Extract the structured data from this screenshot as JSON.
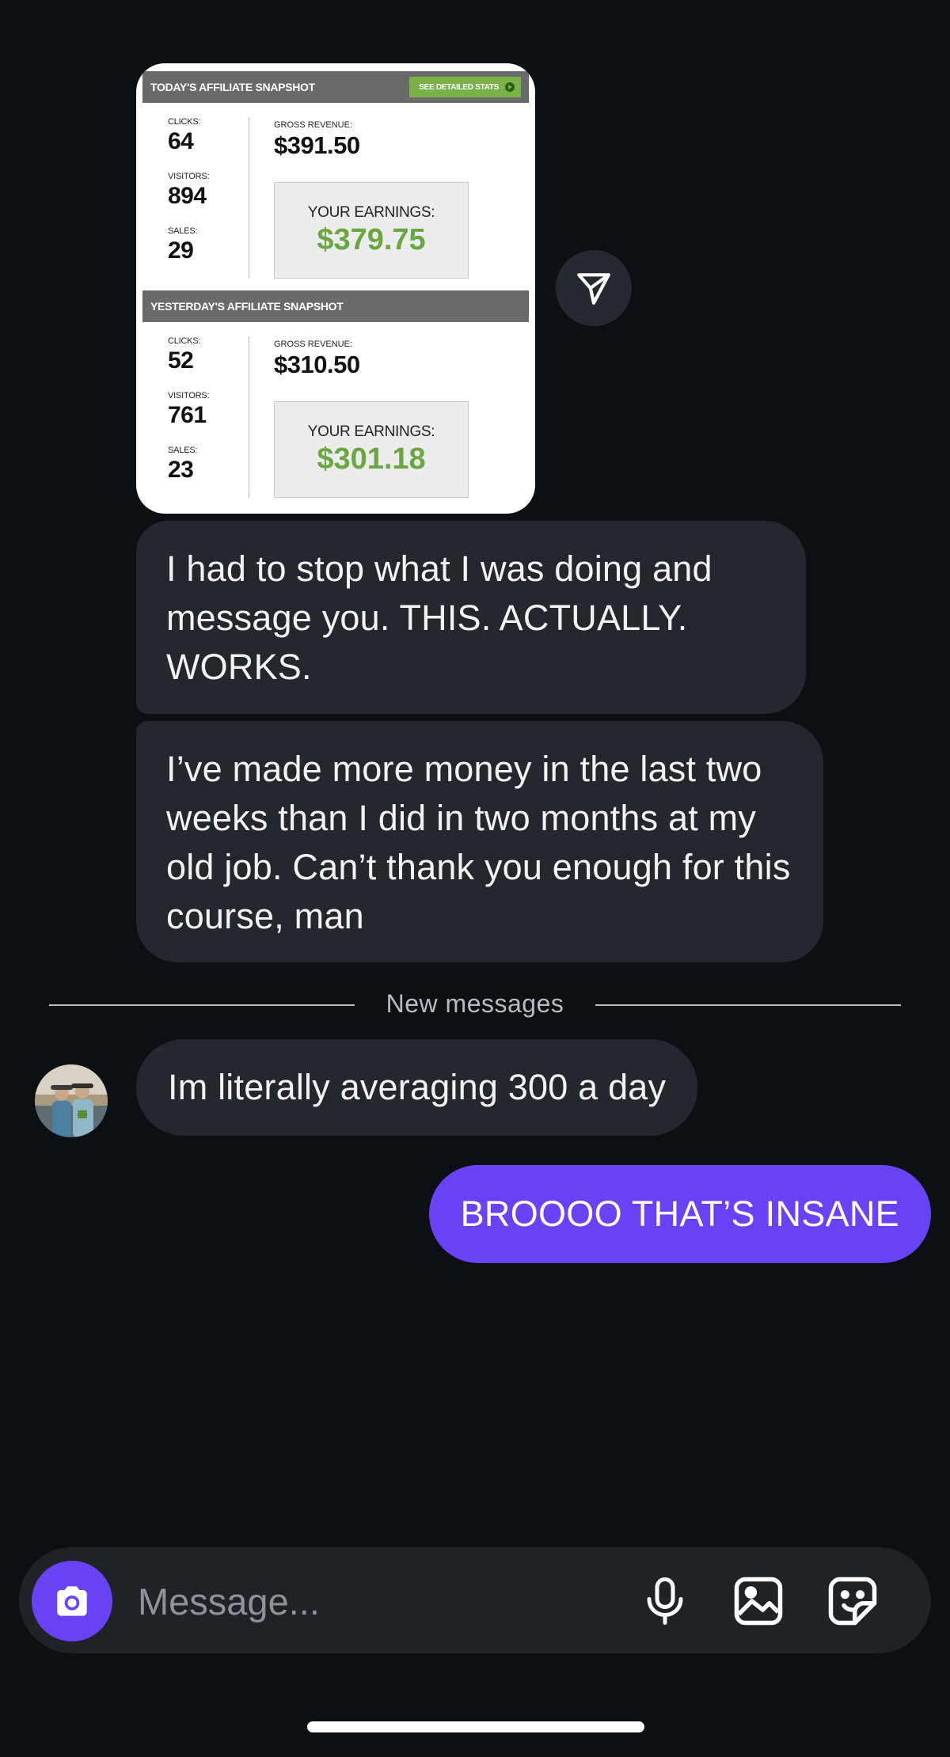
{
  "snapshot": {
    "today": {
      "title": "TODAY'S AFFILIATE SNAPSHOT",
      "stats_button": "SEE DETAILED STATS",
      "clicks_label": "CLICKS:",
      "clicks": "64",
      "visitors_label": "VISITORS:",
      "visitors": "894",
      "sales_label": "SALES:",
      "sales": "29",
      "gross_label": "GROSS REVENUE:",
      "gross": "$391.50",
      "earnings_label": "YOUR EARNINGS:",
      "earnings": "$379.75"
    },
    "yesterday": {
      "title": "YESTERDAY'S AFFILIATE SNAPSHOT",
      "clicks_label": "CLICKS:",
      "clicks": "52",
      "visitors_label": "VISITORS:",
      "visitors": "761",
      "sales_label": "SALES:",
      "sales": "23",
      "gross_label": "GROSS REVENUE:",
      "gross": "$310.50",
      "earnings_label": "YOUR EARNINGS:",
      "earnings": "$301.18"
    }
  },
  "messages": {
    "received_1": "I had to stop what I was doing and message you. THIS. ACTUALLY. WORKS.",
    "received_2": "I’ve made more money in the last two weeks than I did in two months at my old job. Can’t thank you enough for this course, man",
    "divider": "New messages",
    "received_3": "Im literally averaging 300 a day",
    "sent_1": "BROOOO THAT’S INSANE"
  },
  "composer": {
    "placeholder": "Message..."
  },
  "icons": {
    "share": "paper-plane-icon",
    "camera": "camera-icon",
    "mic": "microphone-icon",
    "gallery": "image-icon",
    "sticker": "sticker-icon"
  },
  "colors": {
    "background": "#0c0f14",
    "received_bubble": "#24272d",
    "sent_bubble": "#6a42f5",
    "earnings_green": "#6aa743"
  }
}
